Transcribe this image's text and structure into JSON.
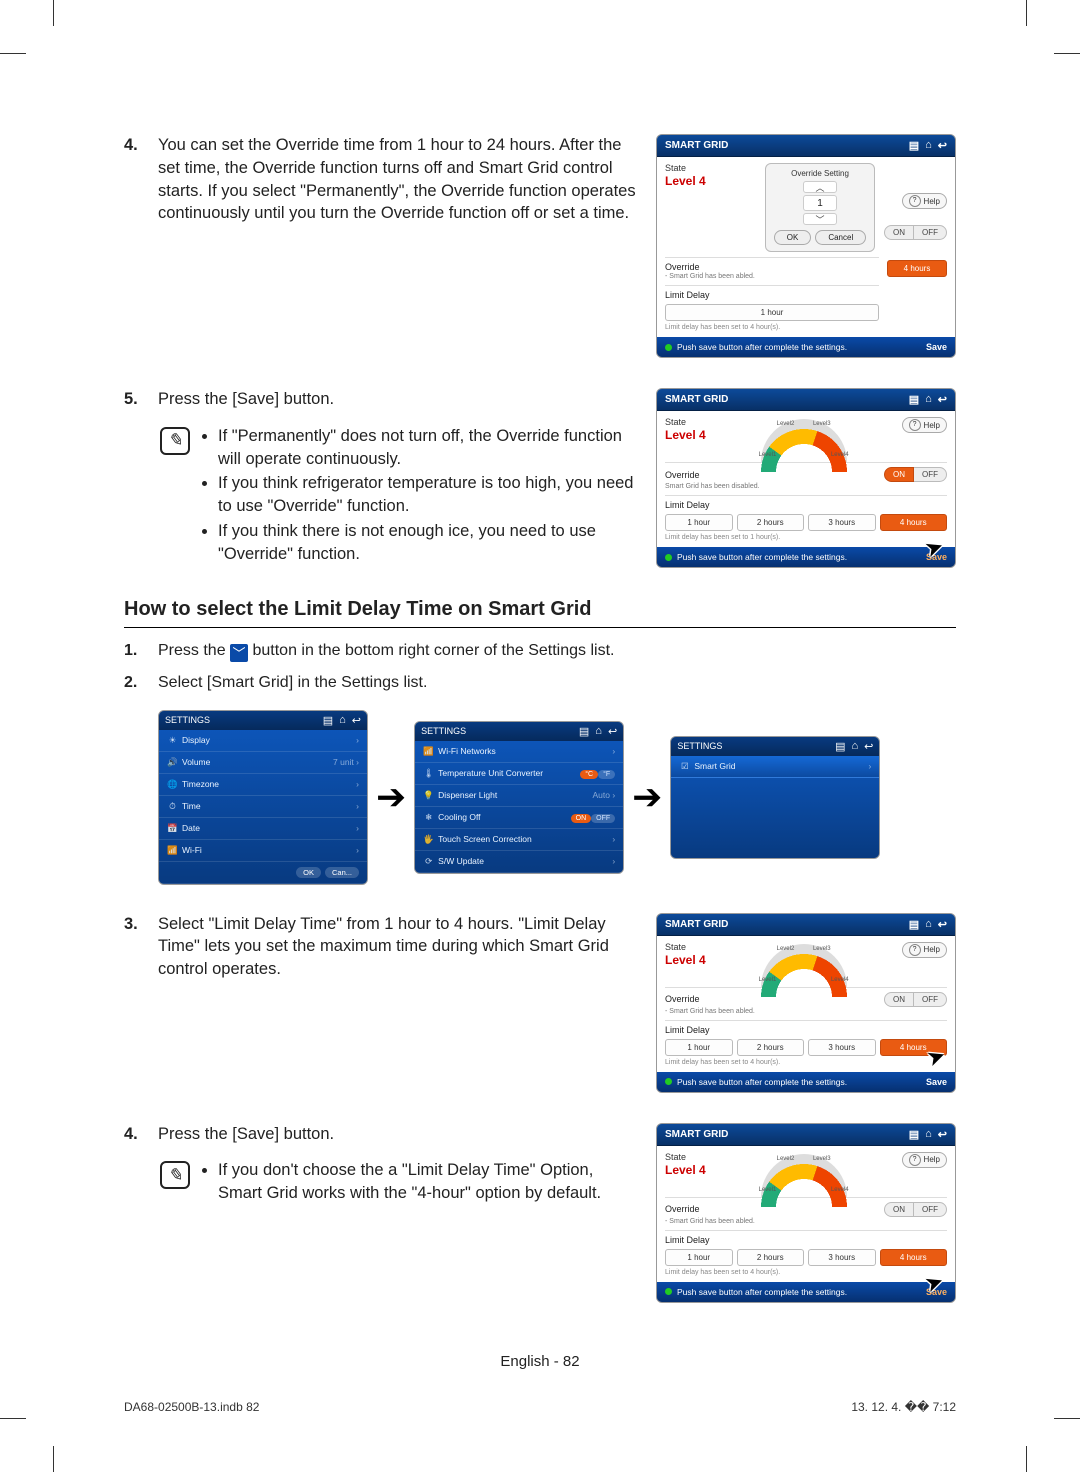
{
  "step4": {
    "num": "4.",
    "text": "You can set the Override time from 1 hour to 24 hours. After the set time, the Override function turns off and Smart Grid control starts. If you select \"Permanently\", the Override function operates continuously until you turn the Override function off or set a time."
  },
  "step5": {
    "num": "5.",
    "text": "Press the [Save] button.",
    "bullets": [
      "If \"Permanently\" does not turn off, the Override function will operate continuously.",
      "If you think refrigerator temperature is too high, you need to use \"Override\" function.",
      "If you think there is not enough ice, you need to use \"Override\" function."
    ]
  },
  "section2": {
    "heading": "How to select the Limit Delay Time on Smart Grid",
    "s1": {
      "num": "1.",
      "pre": "Press the ",
      "post": " button in the bottom right corner of the Settings list."
    },
    "s2": {
      "num": "2.",
      "text": "Select [Smart Grid] in the Settings list."
    },
    "s3": {
      "num": "3.",
      "text": "Select \"Limit Delay Time\" from 1 hour to 4 hours. \"Limit Delay Time\" lets you set the maximum time during which Smart Grid control operates."
    },
    "s4": {
      "num": "4.",
      "text": "Press the [Save] button.",
      "bullets": [
        "If you don't choose the a \"Limit Delay Time\" Option, Smart Grid works with the \"4-hour\" option by default."
      ]
    }
  },
  "shot": {
    "title": "SMART GRID",
    "state_lbl": "State",
    "level": "Level 4",
    "lv1": "Level1",
    "lv2": "Level2",
    "lv3": "Level3",
    "lv4": "Level4",
    "help": "Help",
    "override_lbl": "Override",
    "override_sub_disabled": "- Smart Grid has been abled.",
    "override_sub_disabled2": "Smart Grid has been disabled.",
    "on": "ON",
    "off": "OFF",
    "limit_lbl": "Limit Delay",
    "opts": [
      "1 hour",
      "2 hours",
      "3 hours",
      "4 hours"
    ],
    "fine_1h": "Limit delay has been set to 1 hour(s).",
    "fine_4h": "Limit delay has been set to 4 hour(s).",
    "save_msg": "Push save button after complete the settings.",
    "save": "Save",
    "popup_title": "Override Setting",
    "popup_val": "1",
    "ok": "OK",
    "cancel": "Cancel"
  },
  "settings": {
    "title": "SETTINGS",
    "listA": [
      {
        "icon": "☀",
        "label": "Display"
      },
      {
        "icon": "🔊",
        "label": "Volume",
        "right": "7 unit"
      },
      {
        "icon": "🌐",
        "label": "Timezone"
      },
      {
        "icon": "⏱",
        "label": "Time"
      },
      {
        "icon": "📅",
        "label": "Date"
      },
      {
        "icon": "📶",
        "label": "Wi-Fi"
      }
    ],
    "listB": [
      {
        "icon": "📶",
        "label": "Wi-Fi Networks"
      },
      {
        "icon": "🌡",
        "label": "Temperature Unit Converter",
        "pill": "°C",
        "pill2": "°F"
      },
      {
        "icon": "💡",
        "label": "Dispenser Light",
        "right": "Auto"
      },
      {
        "icon": "❄",
        "label": "Cooling Off",
        "pill": "ON",
        "pill2": "OFF"
      },
      {
        "icon": "🖐",
        "label": "Touch Screen Correction"
      },
      {
        "icon": "⟳",
        "label": "S/W Update"
      }
    ],
    "listC": [
      {
        "icon": "☑",
        "label": "Smart Grid"
      }
    ],
    "ok": "OK",
    "cancel": "Can..."
  },
  "footer": {
    "lang_page": "English - 82",
    "file": "DA68-02500B-13.indb   82",
    "stamp": "13. 12. 4.   �� 7:12"
  }
}
